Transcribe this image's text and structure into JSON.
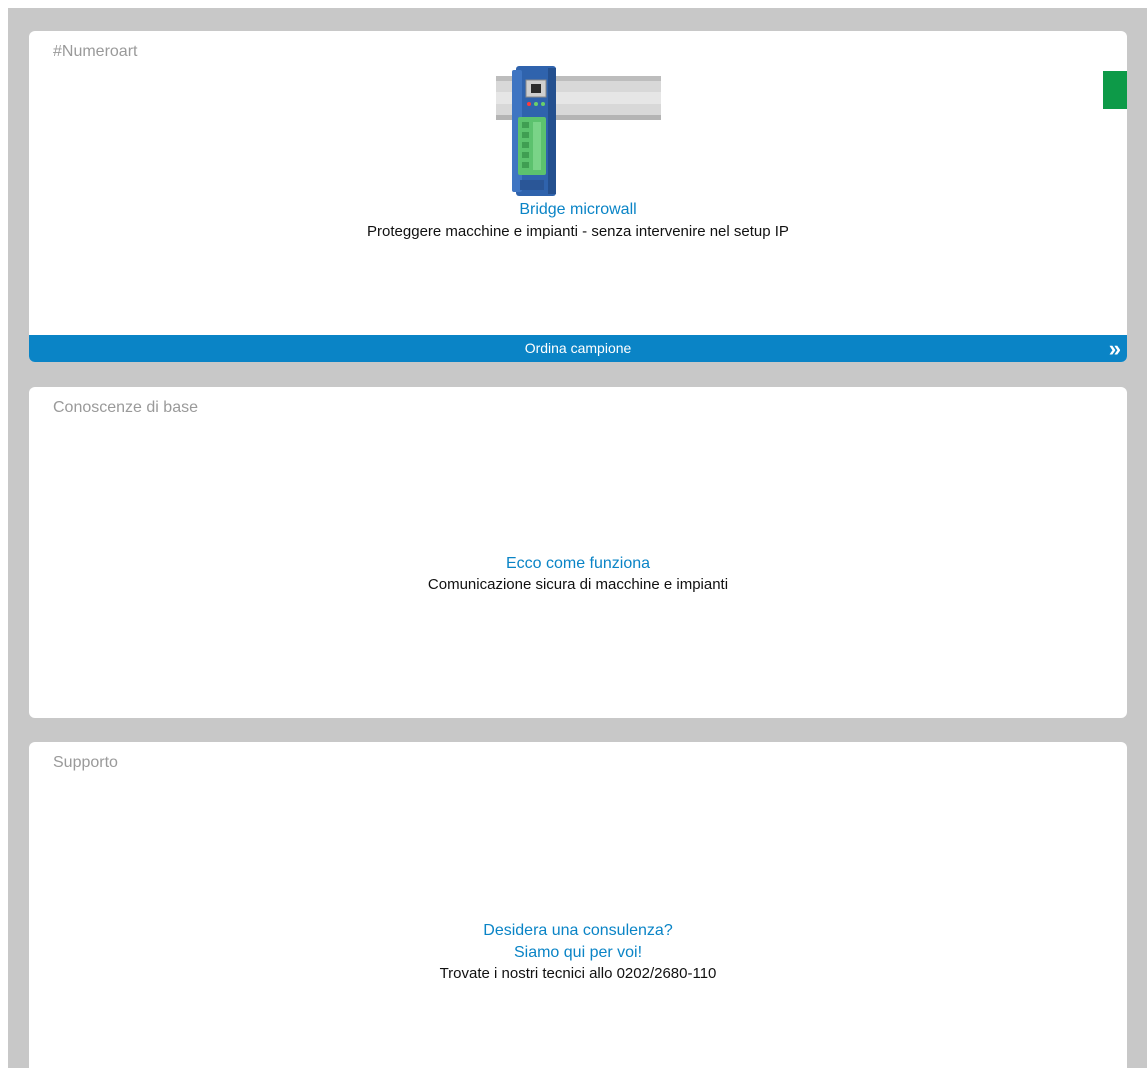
{
  "product_card": {
    "label": "#Numeroart",
    "product_title": "Bridge microwall",
    "product_description": "Proteggere macchine e impianti - senza intervenire nel setup IP",
    "order_label": "Ordina campione",
    "order_icon": "double-chevron-right-icon",
    "marker_color": "#0d9a48",
    "accent_color": "#0a84c6"
  },
  "knowledge_card": {
    "label": "Conoscenze di base",
    "link_title": "Ecco come funziona",
    "description": "Comunicazione sicura di macchine e impianti"
  },
  "support_card": {
    "label": "Supporto",
    "link_title_line1": "Desidera una consulenza?",
    "link_title_line2": "Siamo qui per voi!",
    "description": "Trovate i nostri tecnici allo 0202/2680-110"
  }
}
